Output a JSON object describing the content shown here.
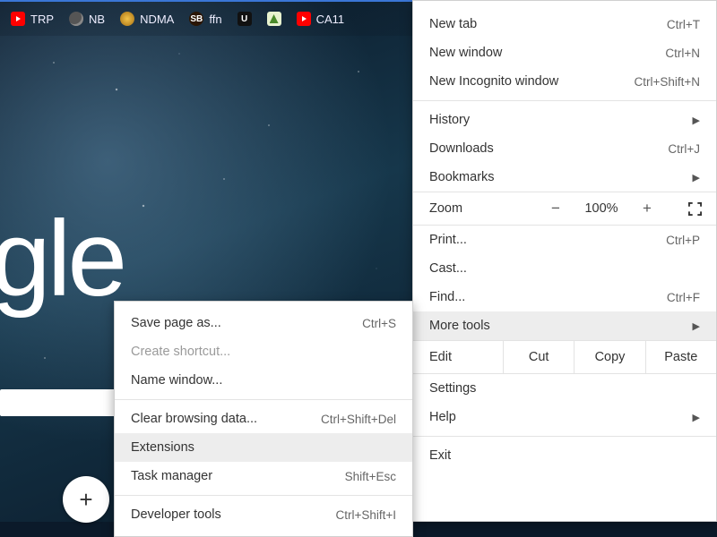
{
  "bookmarks": [
    {
      "label": "TRP",
      "icon": "youtube"
    },
    {
      "label": "NB",
      "icon": "globe"
    },
    {
      "label": "NDMA",
      "icon": "gold"
    },
    {
      "label": "ffn",
      "icon": "sb"
    },
    {
      "label": "",
      "icon": "u",
      "text": "U"
    },
    {
      "label": "",
      "icon": "green"
    },
    {
      "label": "CA11",
      "icon": "youtube"
    }
  ],
  "google_fragment": "gle",
  "add_button": "+",
  "main_menu": {
    "new_tab": {
      "label": "New tab",
      "shortcut": "Ctrl+T"
    },
    "new_window": {
      "label": "New window",
      "shortcut": "Ctrl+N"
    },
    "new_incognito": {
      "label": "New Incognito window",
      "shortcut": "Ctrl+Shift+N"
    },
    "history": {
      "label": "History"
    },
    "downloads": {
      "label": "Downloads",
      "shortcut": "Ctrl+J"
    },
    "bookmarks": {
      "label": "Bookmarks"
    },
    "zoom": {
      "label": "Zoom",
      "minus": "−",
      "value": "100%",
      "plus": "+"
    },
    "print": {
      "label": "Print...",
      "shortcut": "Ctrl+P"
    },
    "cast": {
      "label": "Cast..."
    },
    "find": {
      "label": "Find...",
      "shortcut": "Ctrl+F"
    },
    "more_tools": {
      "label": "More tools"
    },
    "edit": {
      "label": "Edit",
      "cut": "Cut",
      "copy": "Copy",
      "paste": "Paste"
    },
    "settings": {
      "label": "Settings"
    },
    "help": {
      "label": "Help"
    },
    "exit": {
      "label": "Exit"
    }
  },
  "sub_menu": {
    "save_page": {
      "label": "Save page as...",
      "shortcut": "Ctrl+S"
    },
    "create_shortcut": {
      "label": "Create shortcut..."
    },
    "name_window": {
      "label": "Name window..."
    },
    "clear_data": {
      "label": "Clear browsing data...",
      "shortcut": "Ctrl+Shift+Del"
    },
    "extensions": {
      "label": "Extensions"
    },
    "task_manager": {
      "label": "Task manager",
      "shortcut": "Shift+Esc"
    },
    "dev_tools": {
      "label": "Developer tools",
      "shortcut": "Ctrl+Shift+I"
    }
  }
}
